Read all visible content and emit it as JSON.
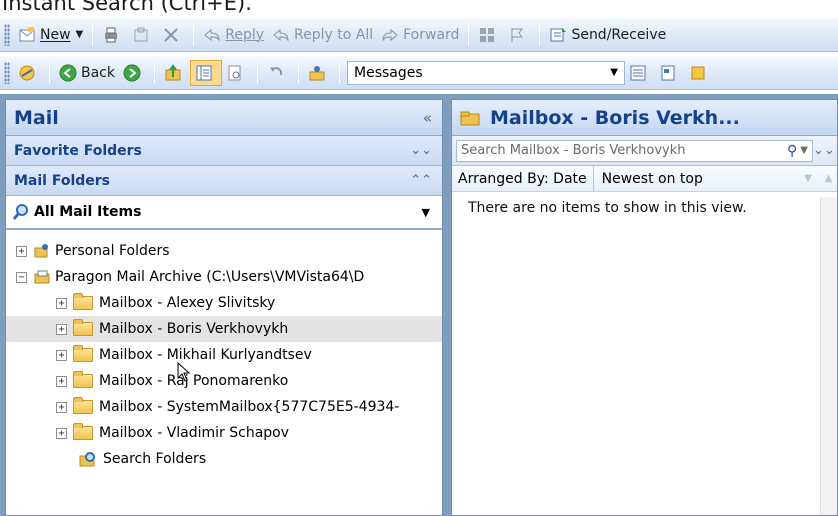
{
  "caption": "Instant Search (Ctrl+E).",
  "toolbar1": {
    "new_label": "New",
    "reply_label": "Reply",
    "reply_all_label": "Reply to All",
    "forward_label": "Forward",
    "send_receive_label": "Send/Receive"
  },
  "toolbar2": {
    "back_label": "Back",
    "folder_combo_value": "Messages"
  },
  "nav": {
    "title": "Mail",
    "favorite_folders": "Favorite Folders",
    "mail_folders": "Mail Folders",
    "all_mail_items": "All Mail Items",
    "tree": {
      "personal": "Personal Folders",
      "archive": "Paragon Mail Archive (C:\\Users\\VMVista64\\D",
      "mailboxes": [
        "Mailbox - Alexey Slivitsky",
        "Mailbox - Boris Verkhovykh",
        "Mailbox - Mikhail Kurlyandtsev",
        "Mailbox - Raj Ponomarenko",
        "Mailbox - SystemMailbox{577C75E5-4934-",
        "Mailbox - Vladimir Schapov"
      ],
      "search_folders": "Search Folders"
    }
  },
  "content": {
    "title": "Mailbox - Boris Verkh...",
    "search_placeholder": "Search Mailbox - Boris Verkhovykh",
    "arranged_by": "Arranged By: Date",
    "sort_order": "Newest on top",
    "empty_message": "There are no items to show in this view."
  },
  "colors": {
    "header_text": "#15428b",
    "pane_border": "#6f8fb4",
    "selected_row": "#e4e4e4"
  }
}
